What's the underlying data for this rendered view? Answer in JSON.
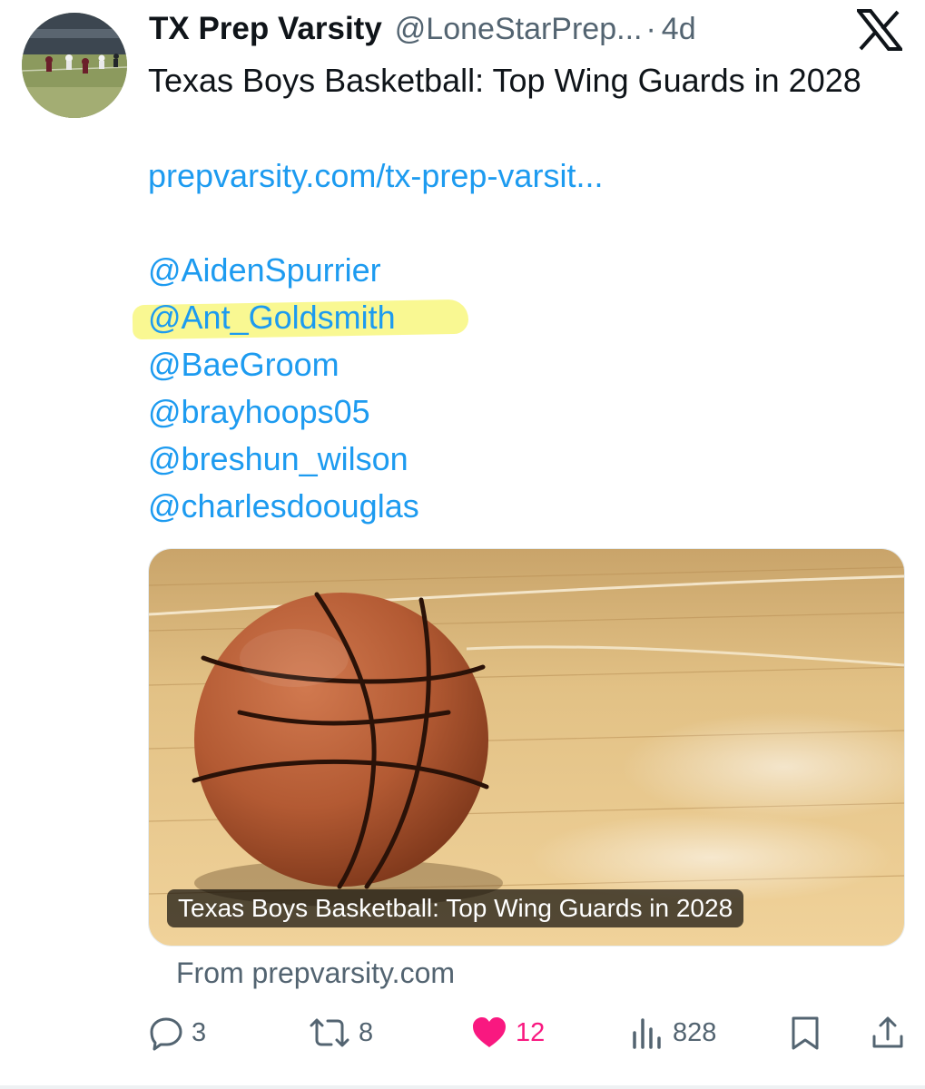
{
  "tweet": {
    "author_name": "TX Prep Varsity",
    "author_handle": "@LoneStarPrep...",
    "separator": "·",
    "time": "4d",
    "text": "Texas Boys Basketball: Top Wing Guards in 2028",
    "link": "prepvarsity.com/tx-prep-varsit...",
    "mentions": [
      "@AidenSpurrier",
      "@Ant_Goldsmith",
      "@BaeGroom",
      "@brayhoops05",
      "@breshun_wilson",
      "@charlesdoouglas"
    ],
    "highlighted_mention_index": 1
  },
  "card": {
    "caption": "Texas Boys Basketball: Top Wing Guards in 2028",
    "source": "From prepvarsity.com"
  },
  "actions": {
    "replies": "3",
    "reposts": "8",
    "likes": "12",
    "views": "828"
  },
  "icons": {
    "platform": "x-logo-icon",
    "reply": "reply-icon",
    "repost": "repost-icon",
    "like": "heart-icon",
    "views": "views-icon",
    "bookmark": "bookmark-icon",
    "share": "share-icon"
  },
  "colors": {
    "link": "#1d9bf0",
    "secondary_text": "#536471",
    "like_active": "#f91880",
    "highlight": "#f7f56e"
  }
}
